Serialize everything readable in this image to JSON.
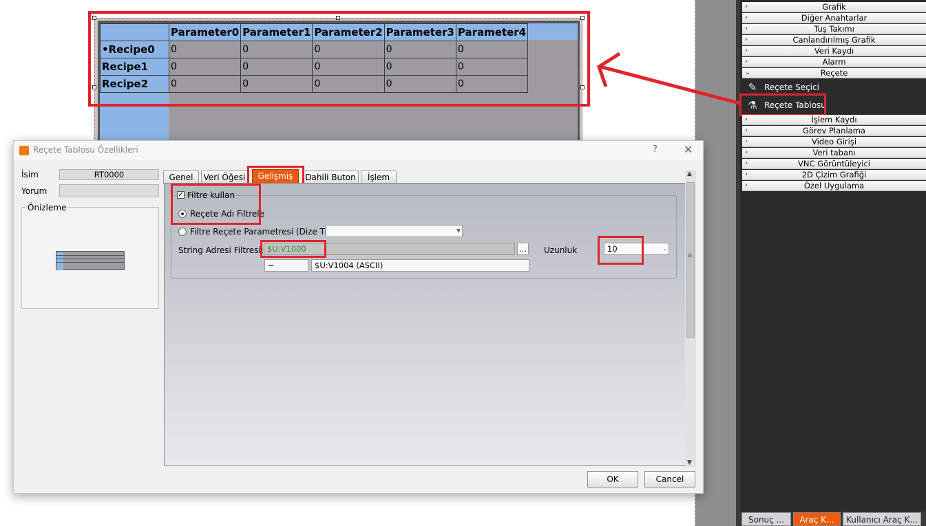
{
  "recipe_table": {
    "columns": [
      "Parameter0",
      "Parameter1",
      "Parameter2",
      "Parameter3",
      "Parameter4"
    ],
    "rows": [
      {
        "name": "•Recipe0",
        "values": [
          "0",
          "0",
          "0",
          "0",
          "0"
        ]
      },
      {
        "name": "Recipe1",
        "values": [
          "0",
          "0",
          "0",
          "0",
          "0"
        ]
      },
      {
        "name": "Recipe2",
        "values": [
          "0",
          "0",
          "0",
          "0",
          "0"
        ]
      }
    ]
  },
  "toolbox": {
    "categories_top": [
      "Grafik",
      "Diğer Anahtarlar",
      "Tuş Takımı",
      "Canlandırılmış Grafik",
      "Veri Kaydı",
      "Alarm",
      "Reçete"
    ],
    "recete_items": [
      "Reçete Seçici",
      "Reçete Tablosu"
    ],
    "categories_bottom": [
      "İşlem Kaydı",
      "Görev Planlama",
      "Video Girişi",
      "Veri tabanı",
      "VNC Görüntüleyici",
      "2D Çizim Grafiği",
      "Özel Uygulama"
    ]
  },
  "bottom_tabs": [
    "Sonuç ...",
    "Araç K...",
    "Kullanıcı Araç K..."
  ],
  "dialog": {
    "title": "Reçete Tablosu Özellikleri",
    "help": "?",
    "close": "✕",
    "name_label": "İsim",
    "name_value": "RT0000",
    "comment_label": "Yorum",
    "comment_value": "",
    "preview_label": "Önizleme",
    "tabs": [
      "Genel",
      "Veri Öğesi",
      "Gelişmiş",
      "Dahili Buton",
      "İşlem"
    ],
    "use_filter_label": "Filtre kullan",
    "filter_by_name_label": "Reçete Adı Filtrele",
    "filter_by_param_label": "Filtre Reçete Parametresi (Dize Tipi)",
    "filter_param_value": "",
    "string_addr_label": "String Adresi Filtresi:",
    "string_addr_value": "$U:V1000",
    "browse_label": "...",
    "length_label": "Uzunluk",
    "length_value": "10",
    "range_sep": "~",
    "range_end": "$U:V1004 (ASCII)",
    "ok": "OK",
    "cancel": "Cancel"
  },
  "colors": {
    "accent": "#f05a0a",
    "highlight": "#e0242c",
    "table_header": "#8cb5e6",
    "table_cell": "#9d9ba0",
    "address_text": "#2e8b2e"
  }
}
